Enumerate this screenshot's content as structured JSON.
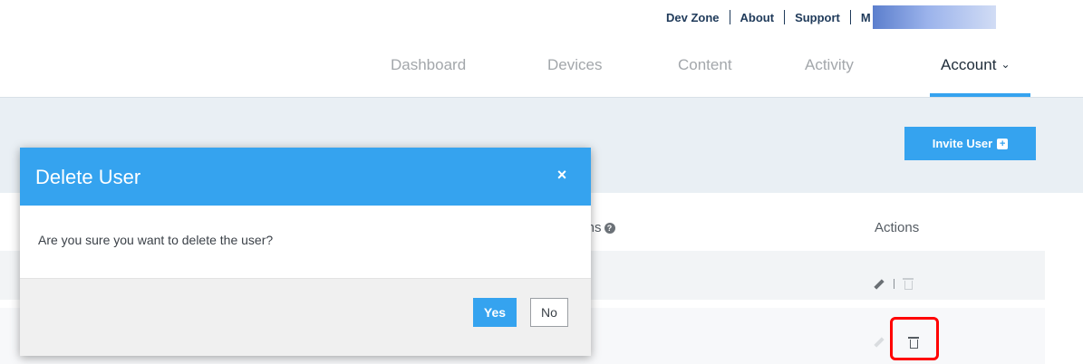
{
  "utility_links": {
    "dev_zone": "Dev Zone",
    "about": "About",
    "support": "Support",
    "partial": "M"
  },
  "nav": {
    "dashboard": "Dashboard",
    "devices": "Devices",
    "content": "Content",
    "activity": "Activity",
    "account": "Account",
    "active_item": "Account"
  },
  "toolbar": {
    "invite_label": "Invite User"
  },
  "table": {
    "permissions_header_partial": "ions",
    "actions_header": "Actions"
  },
  "modal": {
    "title": "Delete User",
    "close_glyph": "×",
    "message": "Are you sure you want to delete the user?",
    "yes_label": "Yes",
    "no_label": "No"
  },
  "colors": {
    "accent": "#35a3ef",
    "highlight": "#ff0000",
    "band": "#e9eff4"
  },
  "icons": [
    "chevron-down-icon",
    "plus-box-icon",
    "help-circle-icon",
    "pencil-icon",
    "trash-icon",
    "close-icon"
  ]
}
